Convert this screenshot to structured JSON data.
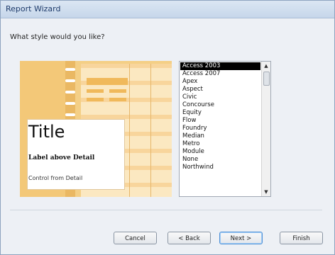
{
  "window": {
    "title": "Report Wizard"
  },
  "prompt": "What style would you like?",
  "preview": {
    "title": "Title",
    "label": "Label above Detail",
    "control": "Control from Detail"
  },
  "styles": {
    "selected": "Access 2003",
    "items": [
      "Access 2003",
      "Access 2007",
      "Apex",
      "Aspect",
      "Civic",
      "Concourse",
      "Equity",
      "Flow",
      "Foundry",
      "Median",
      "Metro",
      "Module",
      "None",
      "Northwind"
    ]
  },
  "buttons": {
    "cancel": "Cancel",
    "back": "< Back",
    "next": "Next >",
    "finish": "Finish"
  },
  "icons": {
    "scroll_up": "up-arrow",
    "scroll_down": "down-arrow"
  }
}
